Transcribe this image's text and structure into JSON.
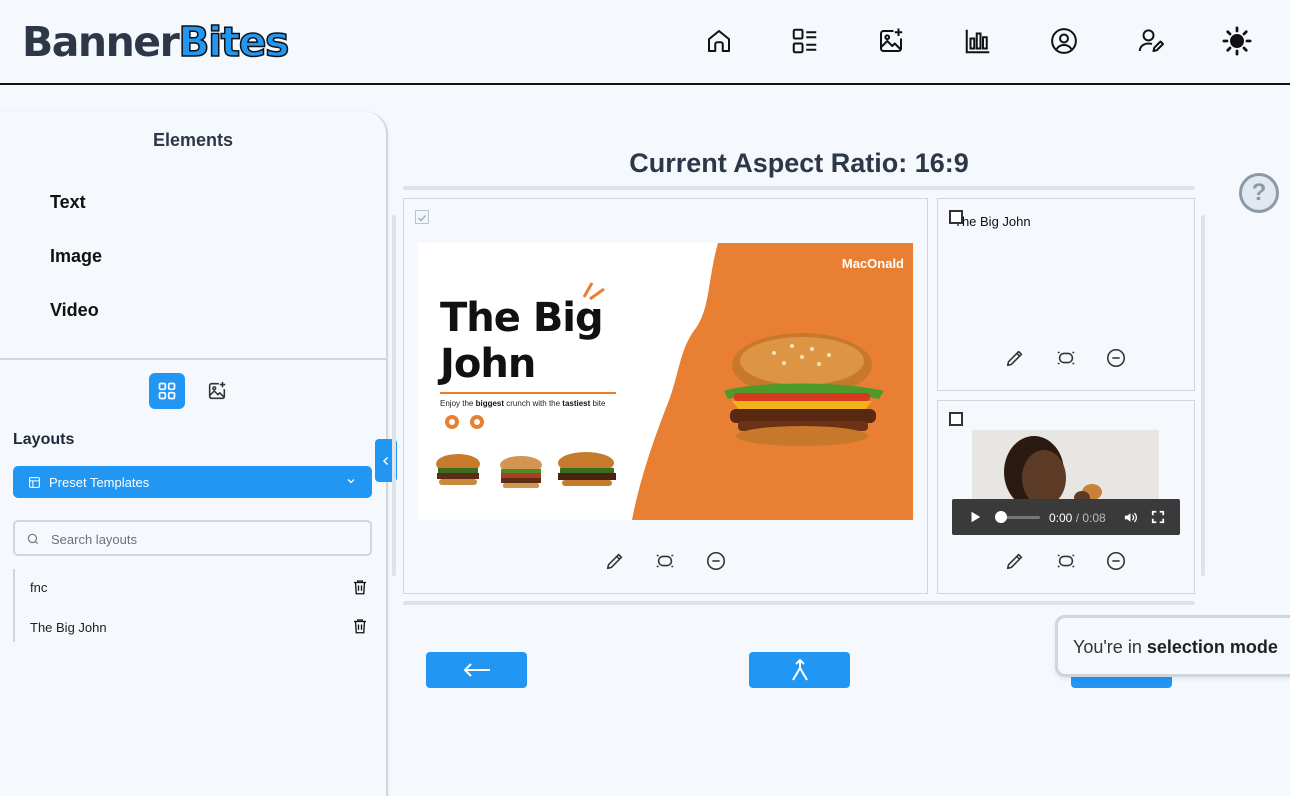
{
  "brand": {
    "part1": "Banner",
    "part2": "Bites"
  },
  "nav": [
    "home-icon",
    "templates-icon",
    "add-image-icon",
    "analytics-icon",
    "account-icon",
    "profile-edit-icon",
    "theme-sun-icon"
  ],
  "sidebar": {
    "elements_title": "Elements",
    "elements": [
      "Text",
      "Image",
      "Video"
    ],
    "layouts_title": "Layouts",
    "preset_label": "Preset Templates",
    "search_placeholder": "Search layouts",
    "layouts": [
      "fnc",
      "The Big John"
    ]
  },
  "main": {
    "aspect_title": "Current Aspect Ratio: 16:9",
    "help_label": "?",
    "small_panel_text": "The Big John",
    "video_time": "0:00",
    "video_duration": "/ 0:08"
  },
  "banner": {
    "brand": "MacOnald",
    "headline_1": "The Big",
    "headline_2": "John",
    "tag_pre": "Enjoy the ",
    "tag_b1": "biggest",
    "tag_mid": " crunch with the ",
    "tag_b2": "tastiest",
    "tag_post": " bite"
  },
  "toast": {
    "prefix": "You're in ",
    "bold": "selection mode"
  },
  "colors": {
    "accent": "#2196f3",
    "orange": "#e87f32"
  }
}
